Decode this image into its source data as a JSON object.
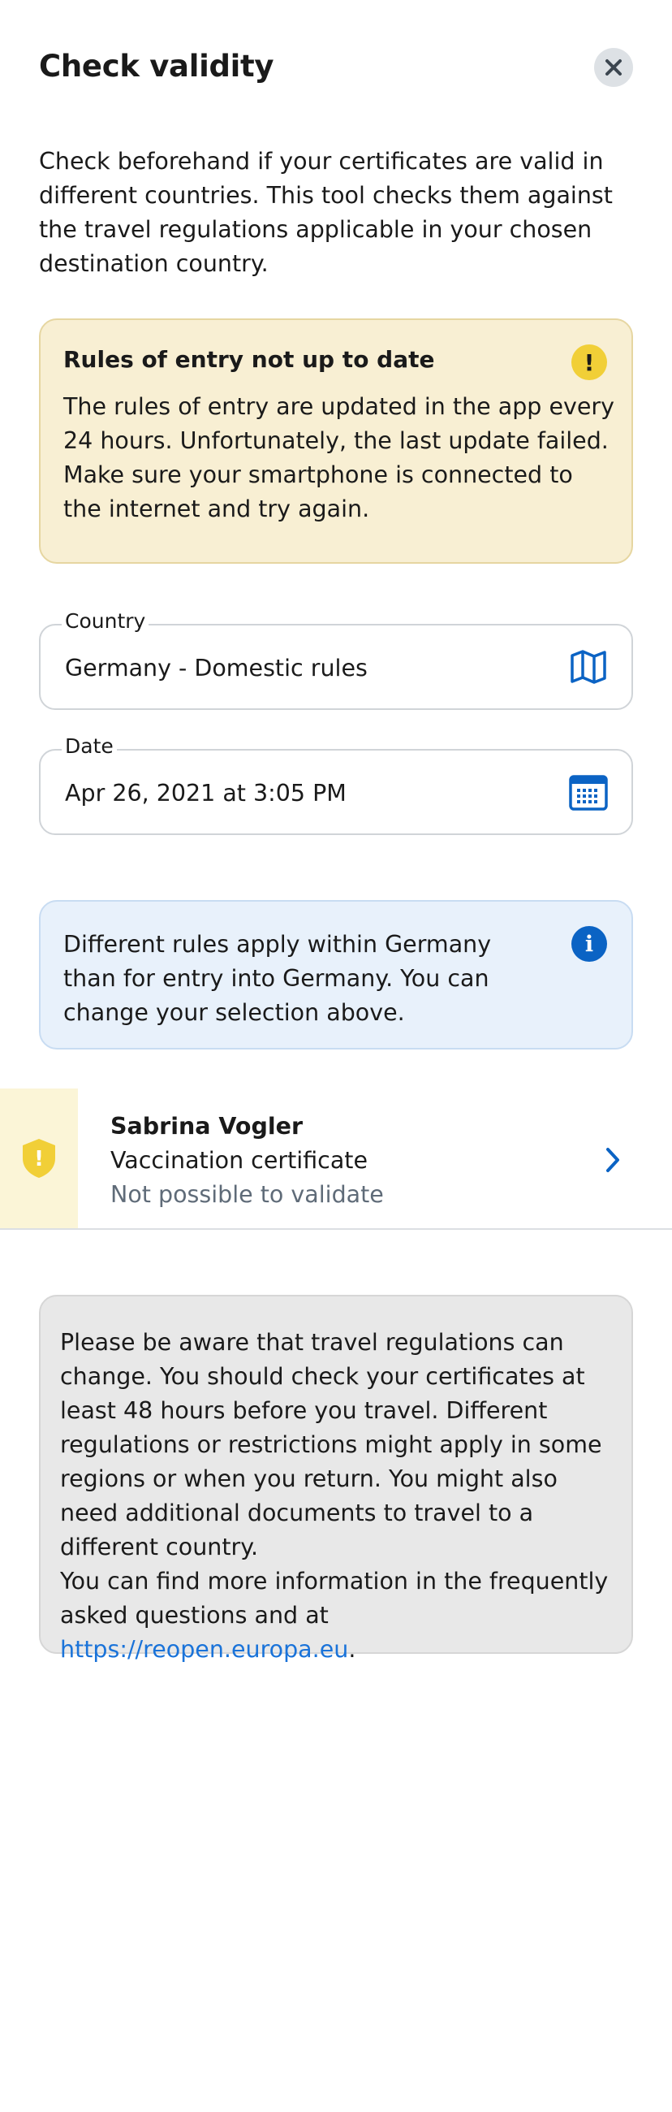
{
  "header": {
    "title": "Check validity",
    "close_icon": "close-icon"
  },
  "intro": {
    "text": "Check beforehand if your certificates are valid in different countries. This tool checks them against the travel regulations applicable in your chosen destination country."
  },
  "warning": {
    "title": "Rules of entry not up to date",
    "text": "The rules of entry are updated in the app every 24 hours. Unfortunately, the last update failed. Make sure your smartphone is connected to the internet and try again.",
    "icon": "exclamation-icon",
    "icon_glyph": "!",
    "background": "#f8efd3",
    "icon_color": "#f1cf37"
  },
  "country_field": {
    "label": "Country",
    "value": "Germany - Domestic rules",
    "icon": "map-icon"
  },
  "date_field": {
    "label": "Date",
    "value": "Apr 26, 2021 at 3:05 PM",
    "icon": "calendar-icon"
  },
  "info": {
    "text": "Different rules apply within Germany than for entry into Germany. You can change your selection above.",
    "icon": "info-icon",
    "icon_glyph": "i",
    "background": "#e8f1fb",
    "icon_color": "#0b63c4"
  },
  "certificate": {
    "name": "Sabrina Vogler",
    "type": "Vaccination certificate",
    "status": "Not possible to validate",
    "status_icon": "shield-warning-icon",
    "status_icon_glyph": "!",
    "chevron_icon": "chevron-right-icon"
  },
  "notice": {
    "paragraph1": "Please be aware that travel regulations can change. You should check your certificates at least 48 hours before you travel. Different regulations or restrictions might apply in some regions or when you return. You might also need additional documents to travel to a different country.",
    "paragraph2_prefix": "You can find more information in the frequently asked questions and at ",
    "link_text": "https://reopen.europa.eu",
    "paragraph2_suffix": "."
  },
  "colors": {
    "accent_blue": "#0b63c4",
    "link_blue": "#1a73d9",
    "warning_yellow": "#f1cf37"
  }
}
